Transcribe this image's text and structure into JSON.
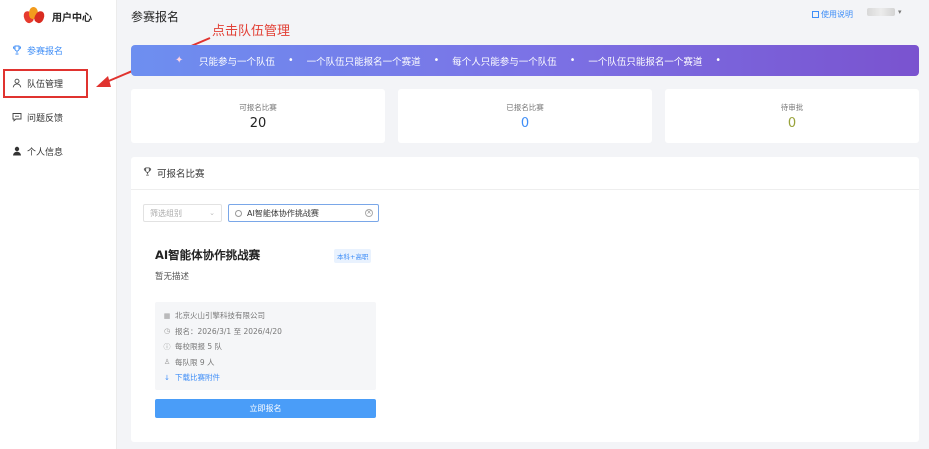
{
  "brand": {
    "title": "用户中心"
  },
  "sidebar": {
    "items": [
      {
        "label": "参赛报名"
      },
      {
        "label": "队伍管理"
      },
      {
        "label": "问题反馈"
      },
      {
        "label": "个人信息"
      }
    ]
  },
  "annotation": {
    "text": "点击队伍管理"
  },
  "header": {
    "page_title": "参赛报名",
    "help_label": "使用说明"
  },
  "banner": {
    "items": [
      "只能参与一个队伍",
      "一个队伍只能报名一个赛道",
      "每个人只能参与一个队伍",
      "一个队伍只能报名一个赛道"
    ],
    "separator": "•"
  },
  "stats": [
    {
      "label": "可报名比赛",
      "value": "20",
      "color": "#222222"
    },
    {
      "label": "已报名比赛",
      "value": "0",
      "color": "#3f8ef7"
    },
    {
      "label": "待审批",
      "value": "0",
      "color": "#99a23a"
    }
  ],
  "panel": {
    "title": "可报名比赛",
    "filter_placeholder": "筛选组别",
    "search_value": "AI智能体协作挑战赛"
  },
  "competition": {
    "title": "AI智能体协作挑战赛",
    "tag": "本科+高职",
    "description": "暂无描述",
    "organizer": "北京火山引擎科技有限公司",
    "period": "报名：2026/3/1 至 2026/4/20",
    "school_limit": "每校限报 5 队",
    "team_size": "每队限 9 人",
    "download": "下载比赛附件",
    "signup_label": "立即报名"
  },
  "colors": {
    "accent": "#3f8ef7",
    "annotation": "#e0332f",
    "banner_start": "#6d8ff0",
    "banner_end": "#7a53cf"
  }
}
